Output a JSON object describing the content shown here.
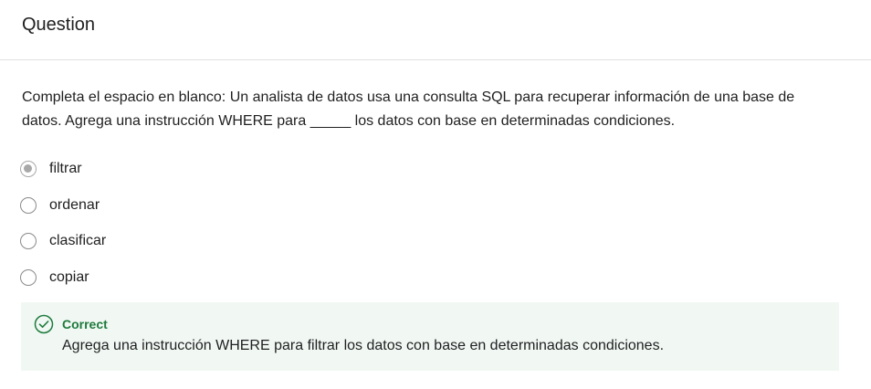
{
  "header": {
    "title": "Question"
  },
  "question": {
    "prompt": "Completa el espacio en blanco: Un analista de datos usa una consulta SQL para recuperar información de una base de datos. Agrega una instrucción WHERE para _____ los datos con base en determinadas condiciones."
  },
  "options": [
    {
      "label": "filtrar",
      "selected": true
    },
    {
      "label": "ordenar",
      "selected": false
    },
    {
      "label": "clasificar",
      "selected": false
    },
    {
      "label": "copiar",
      "selected": false
    }
  ],
  "feedback": {
    "status": "Correct",
    "message": "Agrega una instrucción WHERE para filtrar los datos con base en determinadas condiciones.",
    "icon": "check-circle-icon",
    "status_color": "#1e7a3c",
    "background_color": "#f1f8f4"
  }
}
